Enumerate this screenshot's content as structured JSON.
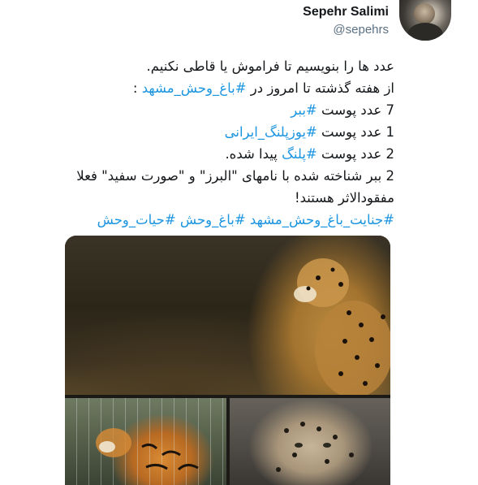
{
  "author": {
    "name": "Sepehr Salimi",
    "handle": "@sepehrs"
  },
  "tweet": {
    "line1": "عدد ها را بنویسیم تا فراموش یا قاطی نکنیم.",
    "line2_prefix": "از هفته گذشته تا امروز در ",
    "line2_hashtag": "#باغ_وحش_مشهد",
    "line2_suffix": " :",
    "line3_prefix": "7 عدد پوست ",
    "line3_hashtag": "#ببر",
    "line4_prefix": "1 عدد پوست ",
    "line4_hashtag": "#یوزپلنگ_ایرانی",
    "line5_prefix": "2 عدد پوست ",
    "line5_hashtag": "#پلنگ",
    "line5_suffix": " پیدا شده.",
    "line6": "2 ببر شناخته شده با نامهای \"البرز\" و \"صورت سفید\" فعلا",
    "line7": "مفقودالاثر هستند!",
    "hashtags_line": "#جنایت_باغ_وحش_مشهد #باغ_وحش #حیات_وحش"
  },
  "colors": {
    "hashtag": "#1b95e0",
    "text": "#14171a",
    "handle": "#5b7083"
  },
  "media": [
    {
      "name": "cheetah-photo"
    },
    {
      "name": "tiger-photo"
    },
    {
      "name": "leopard-photo"
    }
  ]
}
